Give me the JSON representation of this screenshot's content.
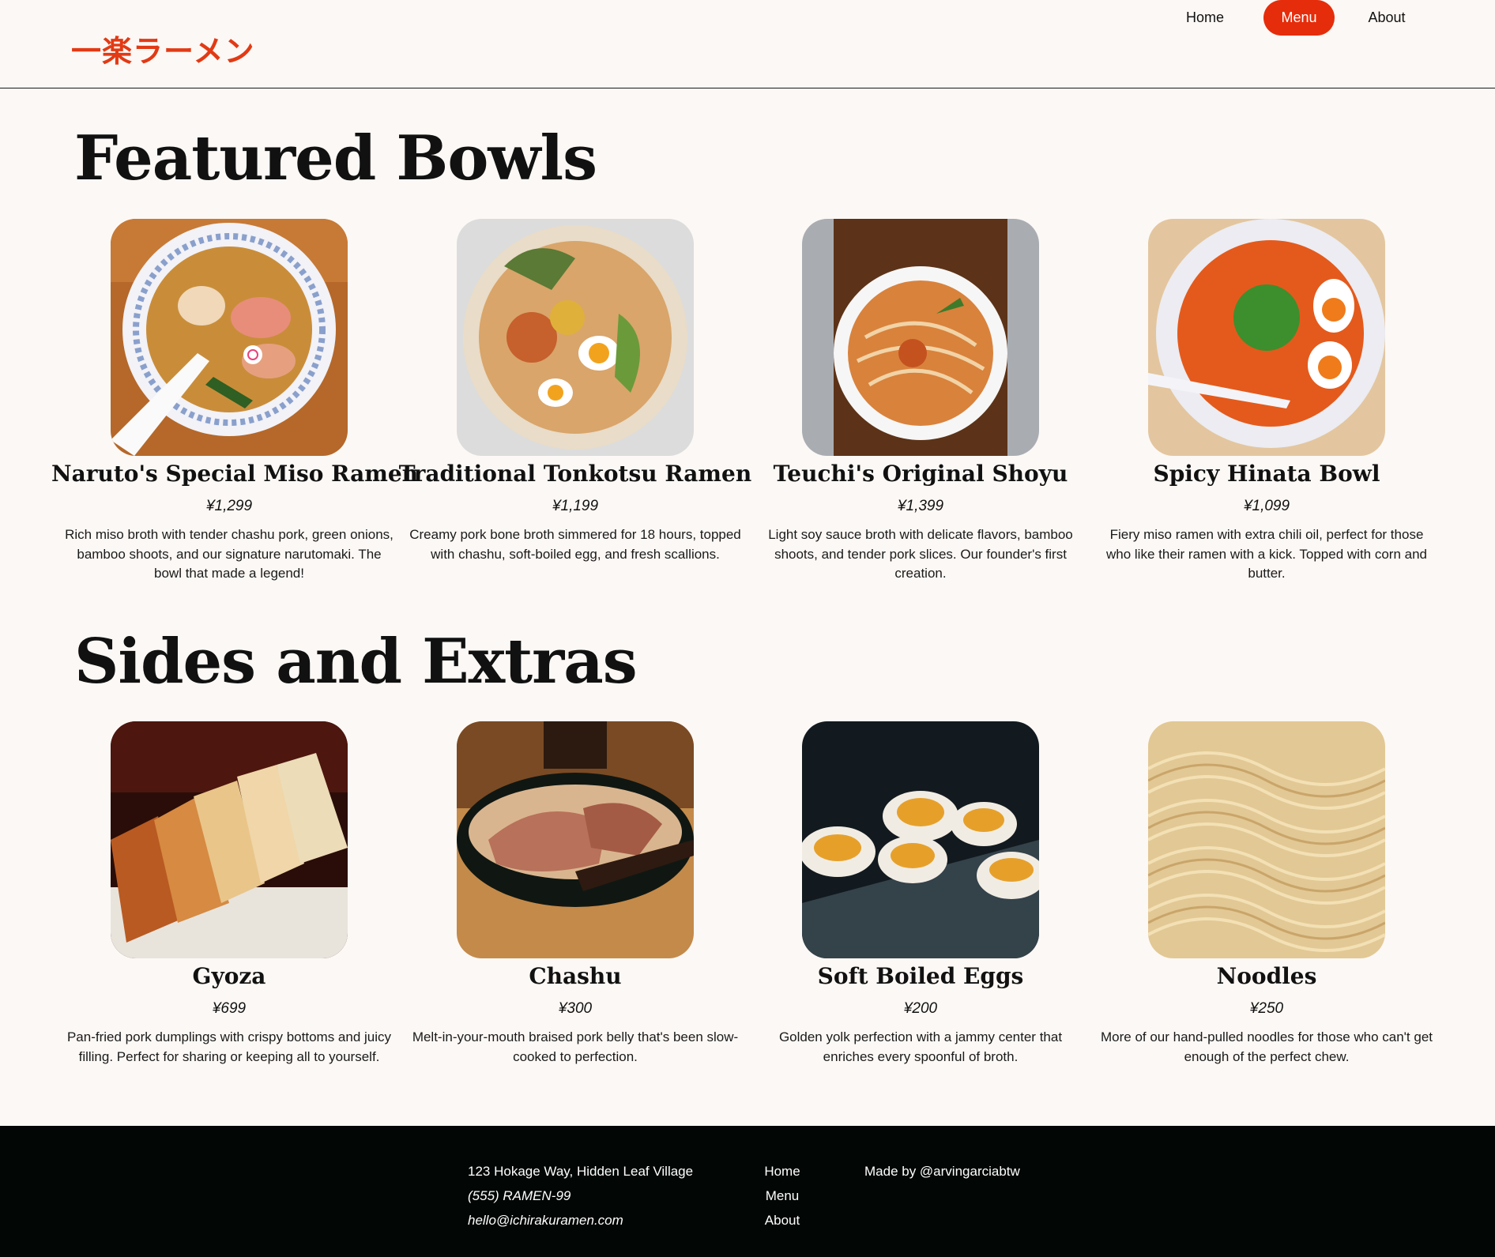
{
  "header": {
    "logo": "一楽ラーメン",
    "nav": {
      "home": "Home",
      "menu": "Menu",
      "about": "About"
    },
    "active_color": "#e52d0b"
  },
  "featured": {
    "title": "Featured Bowls",
    "items": [
      {
        "name": "Naruto's Special Miso Ramen",
        "price": "¥1,299",
        "description": "Rich miso broth with tender chashu pork, green onions, bamboo shoots, and our signature narutomaki. The bowl that made a legend!",
        "icon": "miso-ramen-photo"
      },
      {
        "name": "Traditional Tonkotsu Ramen",
        "price": "¥1,199",
        "description": "Creamy pork bone broth simmered for 18 hours, topped with chashu, soft-boiled egg, and fresh scallions.",
        "icon": "tonkotsu-ramen-photo"
      },
      {
        "name": "Teuchi's Original Shoyu",
        "price": "¥1,399",
        "description": "Light soy sauce broth with delicate flavors, bamboo shoots, and tender pork slices. Our founder's first creation.",
        "icon": "shoyu-ramen-photo"
      },
      {
        "name": "Spicy Hinata Bowl",
        "price": "¥1,099",
        "description": "Fiery miso ramen with extra chili oil, perfect for those who like their ramen with a kick. Topped with corn and butter.",
        "icon": "spicy-ramen-photo"
      }
    ]
  },
  "sides": {
    "title": "Sides and Extras",
    "items": [
      {
        "name": "Gyoza",
        "price": "¥699",
        "description": "Pan-fried pork dumplings with crispy bottoms and juicy filling. Perfect for sharing or keeping all to yourself.",
        "icon": "gyoza-photo"
      },
      {
        "name": "Chashu",
        "price": "¥300",
        "description": "Melt-in-your-mouth braised pork belly that's been slow-cooked to perfection.",
        "icon": "chashu-photo"
      },
      {
        "name": "Soft Boiled Eggs",
        "price": "¥200",
        "description": "Golden yolk perfection with a jammy center that enriches every spoonful of broth.",
        "icon": "eggs-photo"
      },
      {
        "name": "Noodles",
        "price": "¥250",
        "description": "More of our hand-pulled noodles for those who can't get enough of the perfect chew.",
        "icon": "noodles-photo"
      }
    ]
  },
  "footer": {
    "address": "123 Hokage Way, Hidden Leaf Village",
    "phone": "(555) RAMEN-99",
    "email": "hello@ichirakuramen.com",
    "nav": {
      "home": "Home",
      "menu": "Menu",
      "about": "About"
    },
    "credit": "Made by @arvingarciabtw"
  }
}
